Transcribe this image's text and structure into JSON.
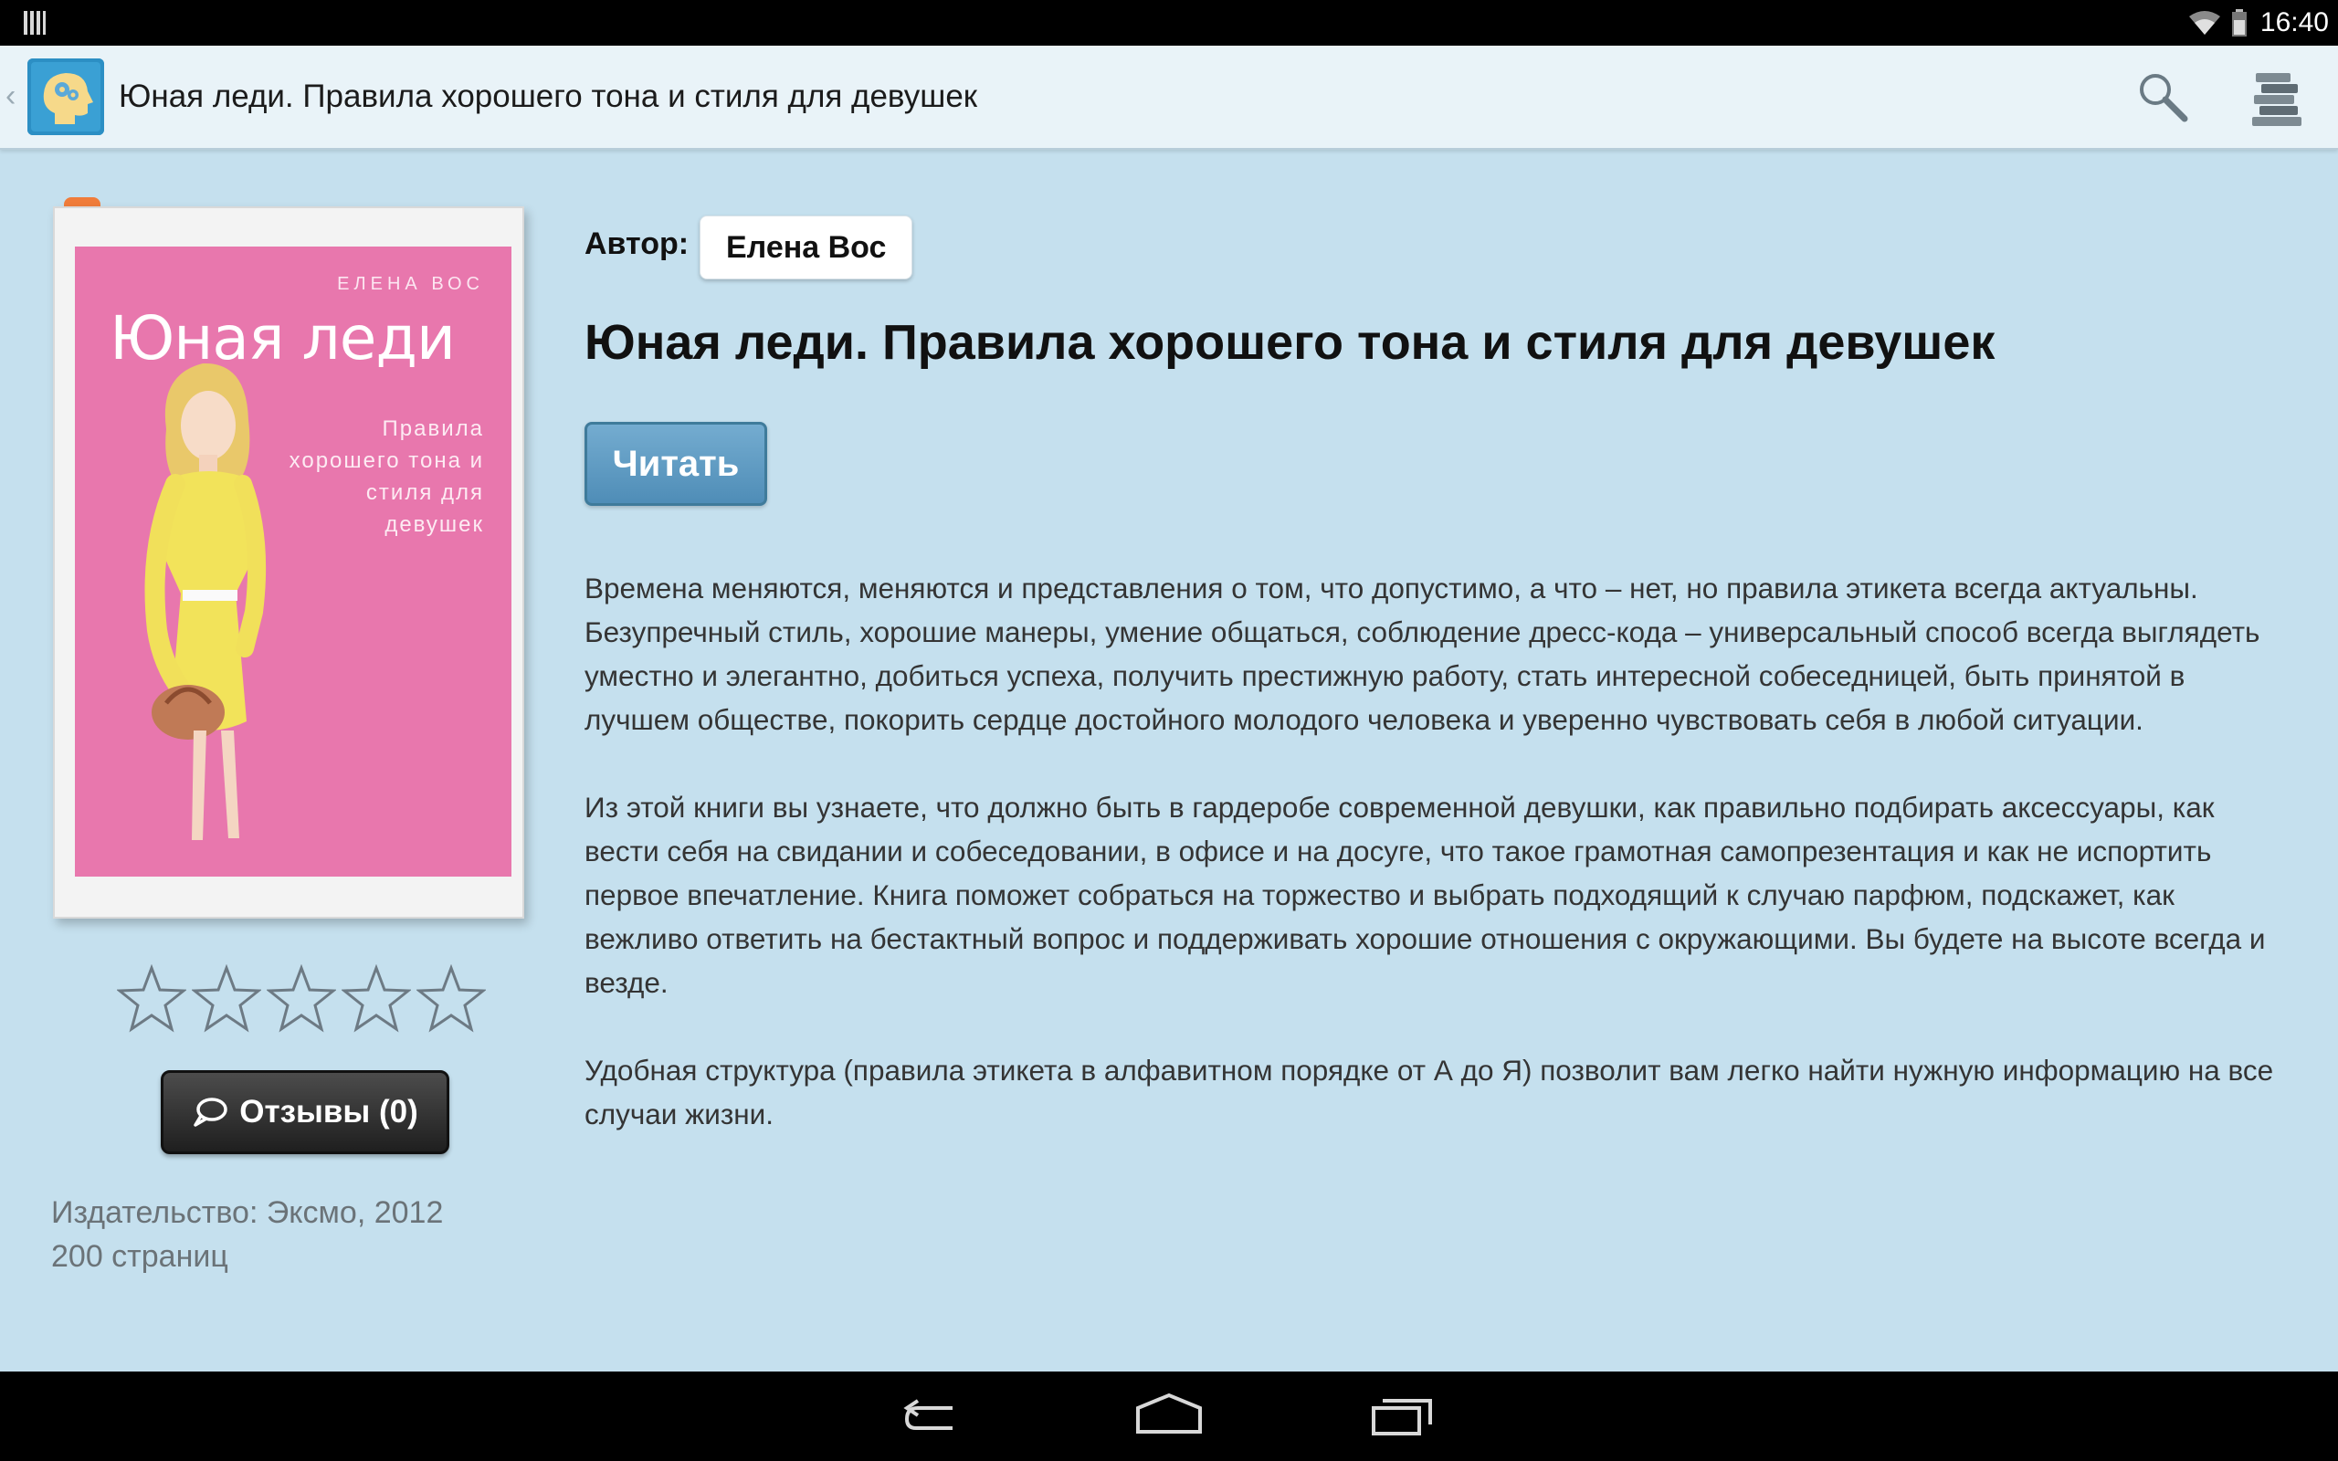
{
  "status_bar": {
    "time": "16:40",
    "icons": [
      "barcode-icon",
      "wifi-icon",
      "battery-icon"
    ]
  },
  "action_bar": {
    "title": "Юная леди. Правила хорошего тона и стиля для девушек",
    "icons": [
      "app-head-gears-icon",
      "search-icon",
      "library-stack-icon"
    ]
  },
  "cover": {
    "author": "ЕЛЕНА ВОС",
    "title": "Юная леди",
    "subtitle": "Правила хорошего тона и стиля для девушек",
    "background_color": "#e877ad"
  },
  "rating": {
    "stars_total": 5,
    "stars_filled": 0
  },
  "reviews": {
    "label": "Отзывы (0)"
  },
  "publisher": {
    "line1": "Издательство: Эксмо, 2012",
    "line2": "200 страниц"
  },
  "book": {
    "author_label": "Автор:",
    "author_name": "Елена Вос",
    "title": "Юная леди. Правила хорошего тона и стиля для девушек",
    "read_label": "Читать",
    "description": [
      "Времена меняются, меняются и представления о том, что допустимо, а что – нет, но правила этикета всегда актуальны. Безупречный стиль, хорошие манеры, умение общаться, соблюдение дресс-кода – универсальный способ всегда выглядеть уместно и элегантно, добиться успеха, получить престижную работу, стать интересной собеседницей, быть принятой в лучшем обществе, покорить сердце достойного молодого человека и уверенно чувствовать себя в любой ситуации.",
      "Из этой книги вы узнаете, что должно быть в гардеробе современной девушки, как правильно подбирать аксессуары, как вести себя на свидании и собеседовании, в офисе и на досуге, что такое грамотная самопрезентация и как не испортить первое впечатление. Книга поможет собраться на торжество и выбрать подходящий к случаю парфюм, подскажет, как вежливо ответить на бестактный вопрос и поддерживать хорошие отношения с окружающими. Вы будете на высоте всегда и везде.",
      "Удобная структура (правила этикета в алфавитном порядке от А до Я) позволит вам легко найти нужную информацию на все случаи жизни."
    ]
  },
  "colors": {
    "background": "#c5e0ee",
    "action_bar": "#e9f3f8",
    "read_button": "#5b98c0",
    "reviews_button": "#2e2e2e",
    "publisher_text": "#6b7378"
  },
  "nav_bar": {
    "icons": [
      "back-icon",
      "home-icon",
      "recents-icon"
    ]
  }
}
